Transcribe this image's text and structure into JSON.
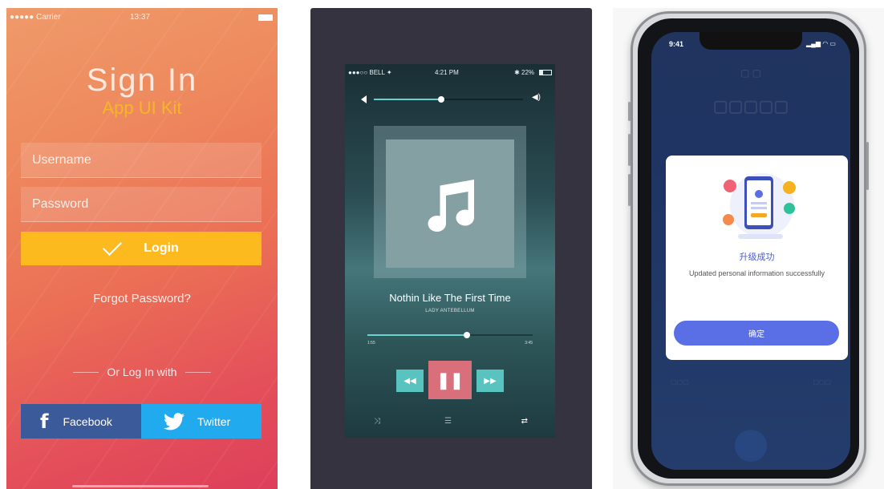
{
  "signin": {
    "status_carrier": "●●●●● Carrier",
    "status_time": "13:37",
    "title": "Sign In",
    "subtitle": "App UI Kit",
    "username_placeholder": "Username",
    "password_placeholder": "Password",
    "login_label": "Login",
    "forgot_label": "Forgot Password?",
    "or_login_with": "Or Log In with",
    "facebook_label": "Facebook",
    "twitter_label": "Twitter",
    "colors": {
      "accent": "#fcba1e",
      "facebook": "#3b5a9a",
      "twitter": "#22aaee"
    }
  },
  "player": {
    "status_left": "●●●○○ BELL ✦",
    "status_time": "4:21 PM",
    "status_battery": "✱ 22%",
    "volume_level": 0.45,
    "song_title": "Nothin Like The First Time",
    "artist": "LADY ANTEBELLUM",
    "progress": 0.6,
    "time_elapsed": "1:55",
    "time_total": "3:45",
    "icons": [
      "volume-low-icon",
      "volume-high-icon",
      "music-note-icon",
      "rewind-icon",
      "pause-icon",
      "forward-icon",
      "shuffle-icon",
      "menu-icon",
      "repeat-icon"
    ],
    "colors": {
      "accent": "#58c3bf",
      "play": "#d96f7b"
    }
  },
  "phone": {
    "status_time": "9:41",
    "modal_title": "升级成功",
    "modal_message": "Updated personal information successfully",
    "confirm_label": "确定",
    "colors": {
      "button": "#5a6ee6",
      "title": "#4a5bd0",
      "screen": "#223e72"
    }
  }
}
